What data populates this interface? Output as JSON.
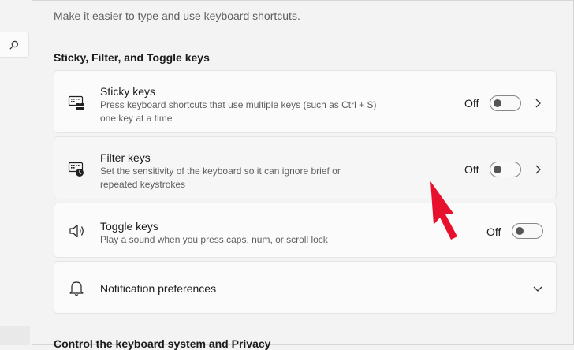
{
  "page": {
    "description": "Make it easier to type and use keyboard shortcuts.",
    "section_title": "Sticky, Filter, and Toggle keys",
    "next_section_title": "Control the keyboard system and Privacy"
  },
  "sidebar": {
    "search_icon": "search-icon"
  },
  "cards": {
    "sticky": {
      "title": "Sticky keys",
      "desc_line1": "Press keyboard shortcuts that use multiple keys (such as Ctrl + S)",
      "desc_line2": "one key at a time",
      "state": "Off",
      "icon": "sticky-keys-icon"
    },
    "filter": {
      "title": "Filter keys",
      "desc_line1": "Set the sensitivity of the keyboard so it can ignore brief or",
      "desc_line2": "repeated keystrokes",
      "state": "Off",
      "icon": "filter-keys-icon"
    },
    "toggle": {
      "title": "Toggle keys",
      "desc": "Play a sound when you press caps, num, or scroll lock",
      "state": "Off",
      "icon": "speaker-icon"
    },
    "notifications": {
      "title": "Notification preferences",
      "icon": "bell-icon"
    }
  },
  "colors": {
    "annotation_arrow": "#e8112d",
    "toggle_knob": "#555555"
  }
}
